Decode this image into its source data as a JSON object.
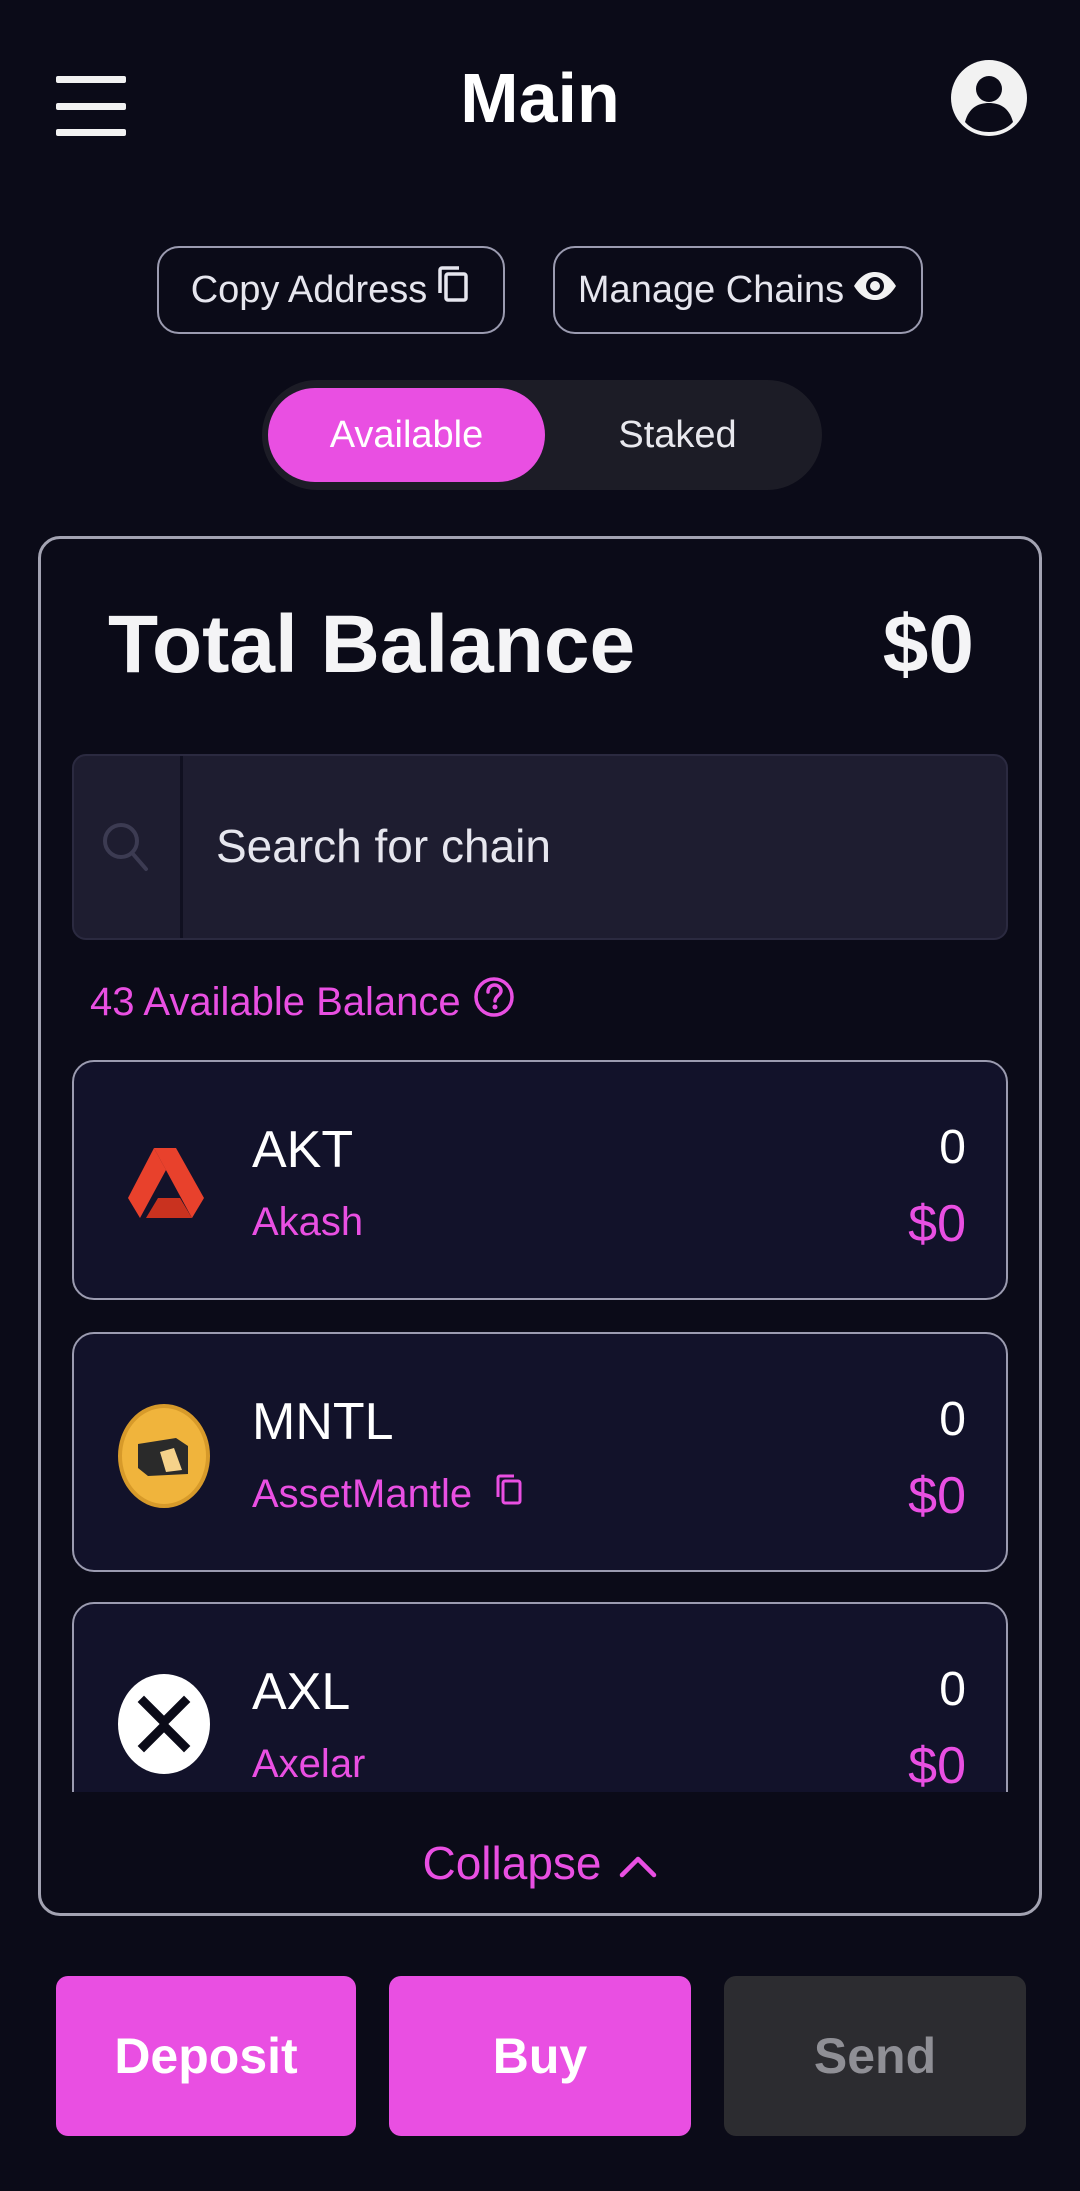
{
  "header": {
    "title": "Main"
  },
  "top_actions": {
    "copy_address_label": "Copy Address",
    "manage_chains_label": "Manage Chains"
  },
  "tabs": [
    {
      "label": "Available",
      "selected": true
    },
    {
      "label": "Staked",
      "selected": false
    }
  ],
  "balance": {
    "label": "Total Balance",
    "value": "$0"
  },
  "search": {
    "placeholder": "Search for chain"
  },
  "available_count_text": "43 Available Balance",
  "tokens": [
    {
      "symbol": "AKT",
      "name": "Akash",
      "amount": "0",
      "value": "$0",
      "icon": "akash-logo-icon"
    },
    {
      "symbol": "MNTL",
      "name": "AssetMantle",
      "amount": "0",
      "value": "$0",
      "icon": "assetmantle-logo-icon"
    },
    {
      "symbol": "AXL",
      "name": "Axelar",
      "amount": "0",
      "value": "$0",
      "icon": "axelar-logo-icon"
    }
  ],
  "collapse_label": "Collapse",
  "bottom_actions": {
    "deposit_label": "Deposit",
    "buy_label": "Buy",
    "send_label": "Send"
  },
  "colors": {
    "background": "#0b0b18",
    "accent": "#e94fe2",
    "card_row": "#12122a",
    "disabled_button": "#2c2c30"
  }
}
